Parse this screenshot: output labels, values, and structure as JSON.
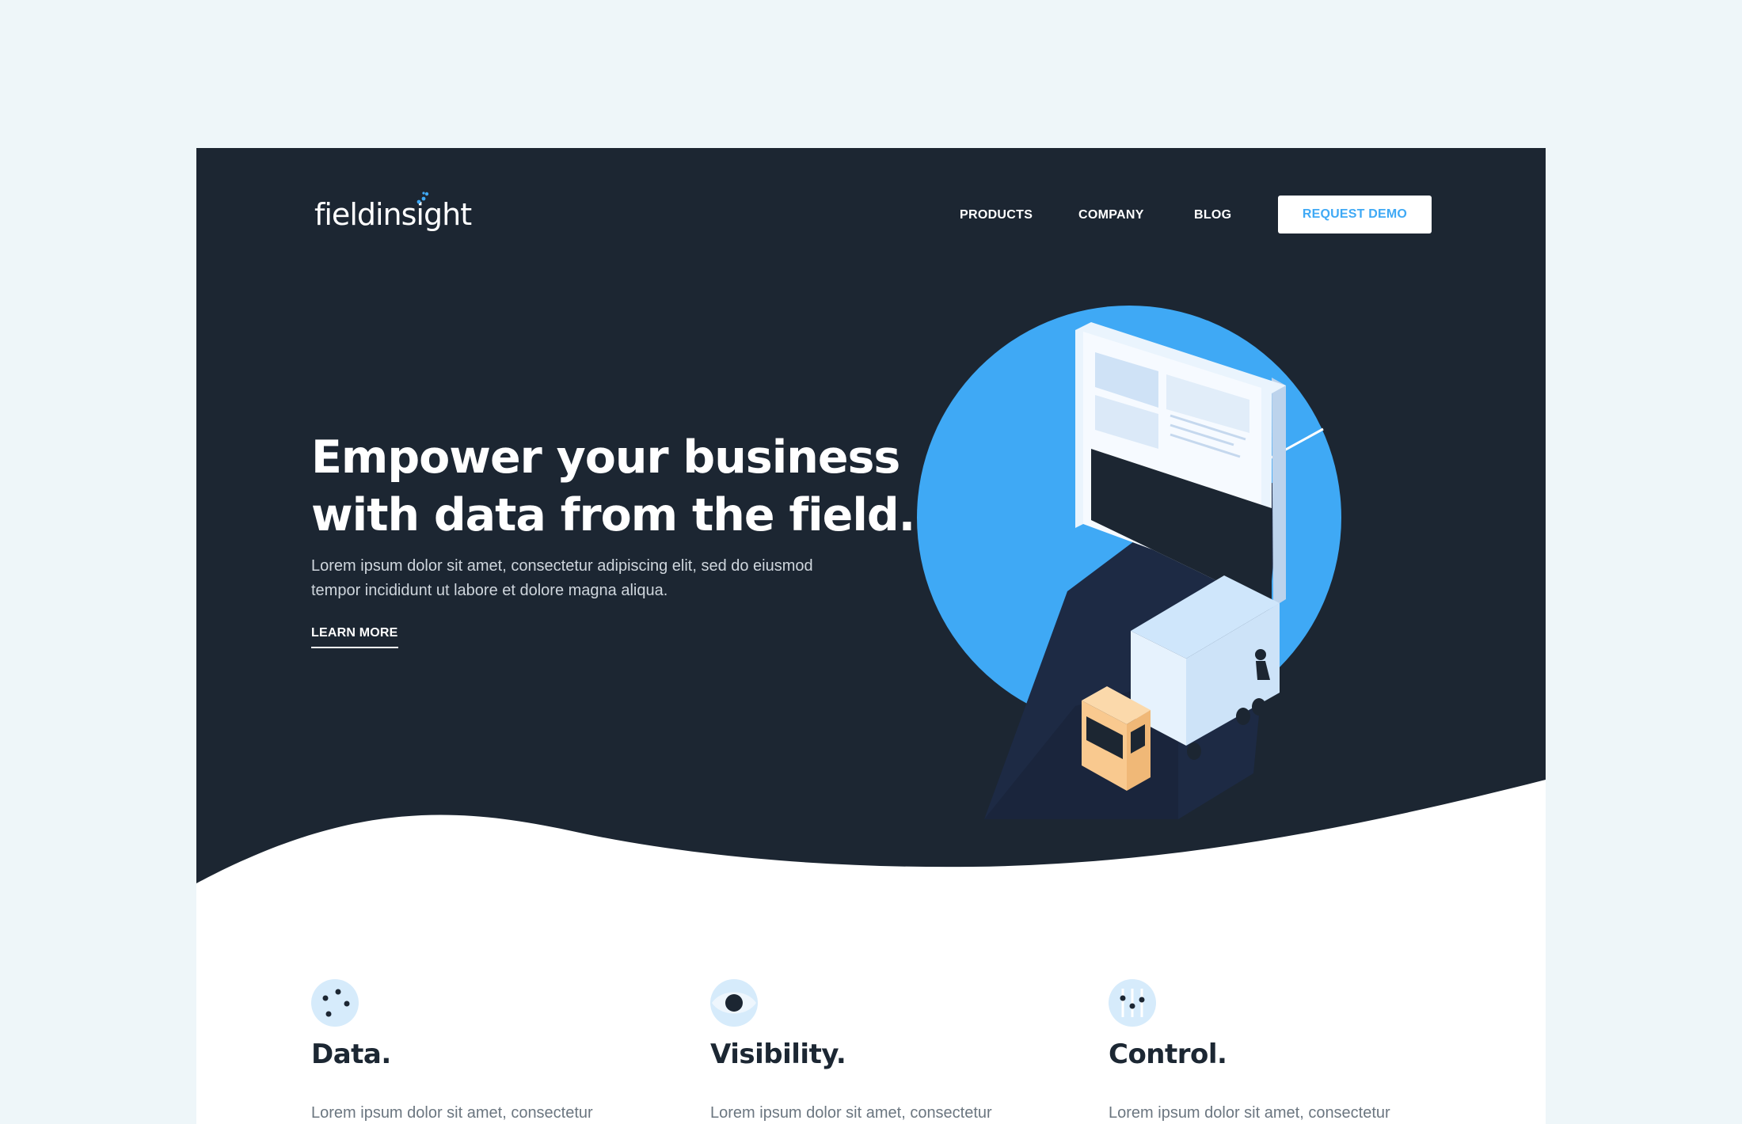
{
  "brand": {
    "logo_text": "fieldinsight"
  },
  "nav": {
    "products_label": "PRODUCTS",
    "company_label": "COMPANY",
    "blog_label": "BLOG",
    "demo_label": "REQUEST DEMO"
  },
  "hero": {
    "headline_line1": "Empower your business",
    "headline_line2": "with data from the field.",
    "subtext": "Lorem ipsum dolor sit amet, consectetur adipiscing elit, sed do eiusmod tempor incididunt ut labore et dolore magna aliqua.",
    "cta_label": "LEARN MORE"
  },
  "features": [
    {
      "title": "Data.",
      "text": "Lorem ipsum dolor sit amet, consectetur",
      "icon": "data-dots-icon"
    },
    {
      "title": "Visibility.",
      "text": "Lorem ipsum dolor sit amet, consectetur",
      "icon": "eye-icon"
    },
    {
      "title": "Control.",
      "text": "Lorem ipsum dolor sit amet, consectetur",
      "icon": "sliders-icon"
    }
  ],
  "colors": {
    "hero_background": "#1c2632",
    "accent_blue": "#3fa9f5",
    "page_background": "#eef6f9",
    "truck_cab": "#f9c98f",
    "icon_circle": "#d6ebfb",
    "heading_text": "#1c2733"
  }
}
